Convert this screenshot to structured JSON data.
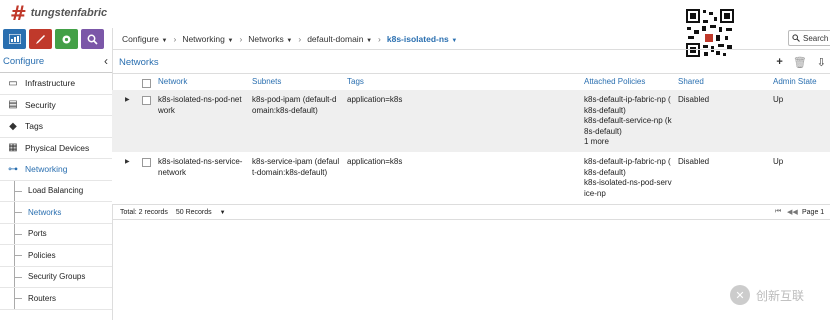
{
  "brand": {
    "mark": "#",
    "name": "tungstenfabric"
  },
  "toolbar": {
    "colors": [
      "#2a6fb0",
      "#c0392b",
      "#43a047",
      "#7b57a8"
    ]
  },
  "breadcrumb": [
    {
      "label": "Configure"
    },
    {
      "label": "Networking"
    },
    {
      "label": "Networks"
    },
    {
      "label": "default-domain"
    },
    {
      "label": "k8s-isolated-ns"
    }
  ],
  "search": {
    "label": "Search"
  },
  "sidebar": {
    "title": "Configure",
    "items": [
      {
        "label": "Infrastructure",
        "icon": "monitor-icon"
      },
      {
        "label": "Security",
        "icon": "document-icon"
      },
      {
        "label": "Tags",
        "icon": "tag-icon"
      },
      {
        "label": "Physical Devices",
        "icon": "server-icon"
      },
      {
        "label": "Networking",
        "icon": "network-icon"
      }
    ],
    "sub_items": [
      "Load Balancing",
      "Networks",
      "Ports",
      "Policies",
      "Security Groups",
      "Routers"
    ]
  },
  "panel": {
    "title": "Networks"
  },
  "table": {
    "headers": [
      "Network",
      "Subnets",
      "Tags",
      "Attached Policies",
      "Shared",
      "Admin State"
    ],
    "rows": [
      {
        "network": [
          "k8s-isolated-ns-pod-net",
          "work"
        ],
        "subnets": [
          "k8s-pod-ipam (default-d",
          "omain:k8s-default)"
        ],
        "tags": "application=k8s",
        "policies": [
          "k8s-default-ip-fabric-np (",
          "k8s-default)",
          "k8s-default-service-np (k",
          "8s-default)",
          "1 more"
        ],
        "shared": "Disabled",
        "admin": "Up"
      },
      {
        "network": [
          "k8s-isolated-ns-service-",
          "network"
        ],
        "subnets": [
          "k8s-service-ipam (defaul",
          "t-domain:k8s-default)"
        ],
        "tags": "application=k8s",
        "policies": [
          "k8s-default-ip-fabric-np (",
          "k8s-default)",
          "k8s-isolated-ns-pod-serv",
          "ice-np"
        ],
        "shared": "Disabled",
        "admin": "Up"
      }
    ]
  },
  "footer": {
    "total": "Total: 2 records",
    "page_size": "50 Records",
    "page": "Page 1"
  },
  "watermark": {
    "text": "创新互联"
  }
}
